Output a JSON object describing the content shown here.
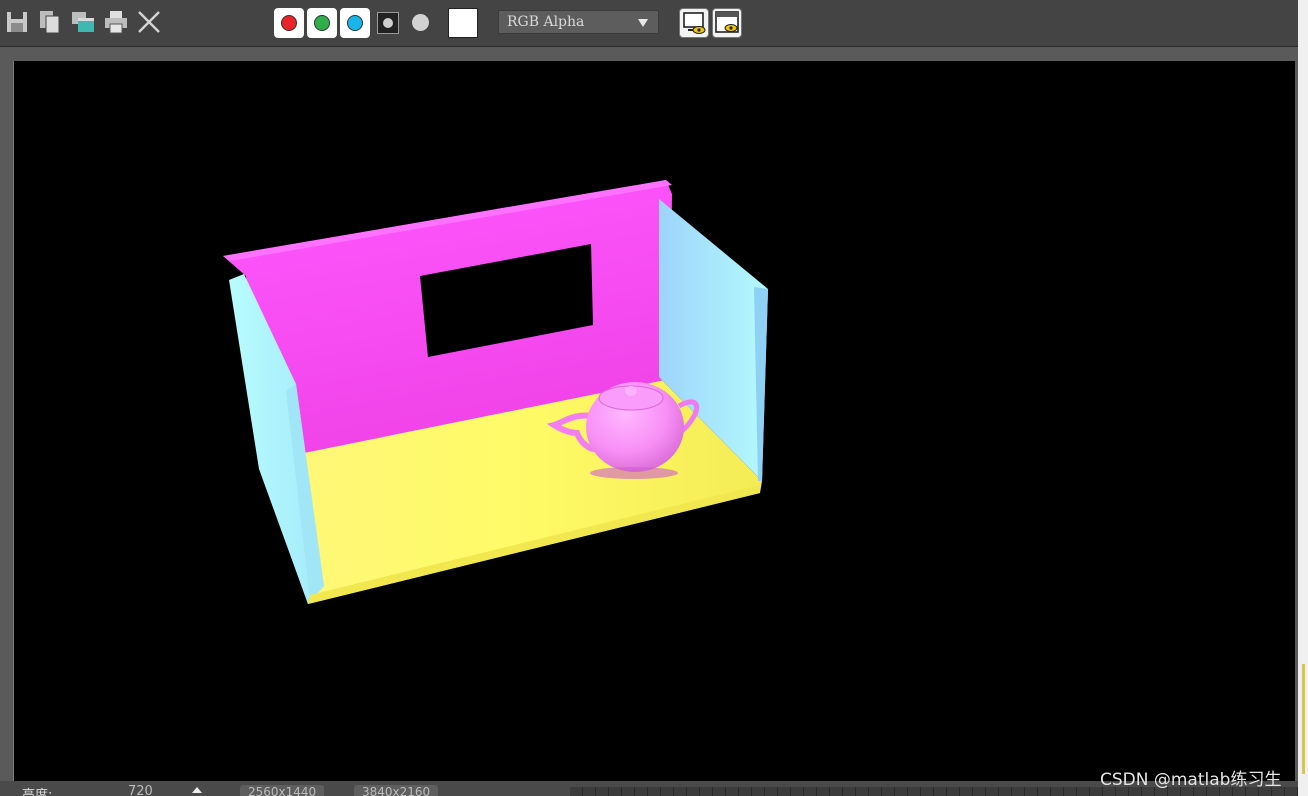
{
  "toolbar": {
    "icons": [
      "save-icon",
      "copy-icon",
      "clone-window-icon",
      "print-icon",
      "close-icon"
    ],
    "channels": {
      "red": "#e8232a",
      "green": "#2fae4a",
      "blue": "#18b4ea"
    },
    "channel_dropdown": {
      "selected": "RGB Alpha"
    },
    "swatch_color": "#ffffff"
  },
  "viewport": {
    "background": "#000000",
    "colors": {
      "back_wall": "#ff4ffd",
      "side_walls": "#aef8fb",
      "floor": "#fdf86a",
      "teapot": "#f88af8"
    }
  },
  "statusbar": {
    "height_label": "高度:",
    "height_value": "720",
    "preset_1": "2560x1440",
    "preset_2": "3840x2160"
  },
  "watermark": "CSDN @matlab练习生"
}
